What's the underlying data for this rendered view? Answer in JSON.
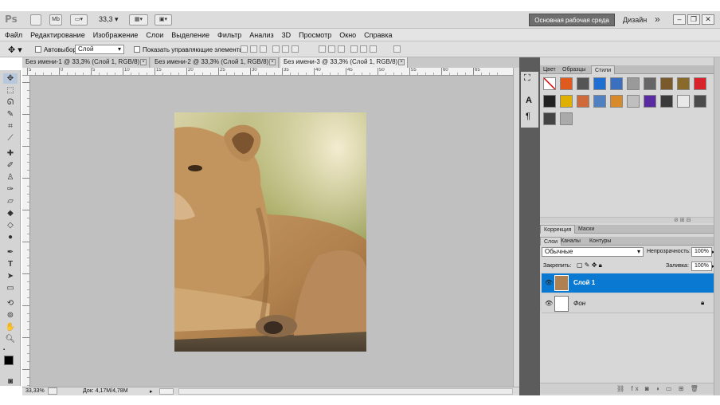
{
  "appbar": {
    "logo": "Ps",
    "mb_label": "Mb",
    "zoom_value": "33,3",
    "workspace_button": "Основная рабочая среда",
    "design_label": "Дизайн",
    "more_label": "»"
  },
  "menu": {
    "items": [
      "Файл",
      "Редактирование",
      "Изображение",
      "Слои",
      "Выделение",
      "Фильтр",
      "Анализ",
      "3D",
      "Просмотр",
      "Окно",
      "Справка"
    ]
  },
  "options": {
    "autoselect_label": "Автовыбор:",
    "autoselect_value": "Слой",
    "show_controls_label": "Показать управляющие элементы"
  },
  "tabs": [
    {
      "label": "Без имени-1 @ 33,3% (Слой 1, RGB/8) *"
    },
    {
      "label": "Без имени-2 @ 33,3% (Слой 1, RGB/8) *"
    },
    {
      "label": "Без имени-3 @ 33,3% (Слой 1, RGB/8) *"
    }
  ],
  "ruler_labels": [
    "5",
    "0",
    "5",
    "10",
    "15",
    "20",
    "25",
    "30",
    "35",
    "40",
    "45",
    "50",
    "55",
    "60",
    "65"
  ],
  "status": {
    "zoom": "33,33%",
    "doc": "Док: 4,17M/4,78M"
  },
  "styles_panel": {
    "tabs": [
      "Цвет",
      "Образцы",
      "Стили"
    ],
    "active_tab": "Стили",
    "swatch_colors": [
      "#ffffff",
      "#e05a1e",
      "#555555",
      "#1e6fd1",
      "#3b6fbf",
      "#9a9a9a",
      "#666666",
      "#7a5a2a",
      "#8a6a2a",
      "#d8232a",
      "#222222",
      "#e0b000",
      "#d06a3a",
      "#5080c0",
      "#d88a2a",
      "#bfbfbf",
      "#5a2aa0",
      "#3a3a3a",
      "#e8e8e8",
      "#4a4a4a",
      "#444444",
      "#aaaaaa"
    ]
  },
  "adjust_panel": {
    "tabs": [
      "Коррекция",
      "Маски"
    ]
  },
  "layers_panel": {
    "tabs": [
      "Слои",
      "Каналы",
      "Контуры"
    ],
    "blend_mode": "Обычные",
    "opacity_label": "Непрозрачность:",
    "opacity_value": "100%",
    "lock_label": "Закрепить:",
    "fill_label": "Заливка:",
    "fill_value": "100%",
    "layers": [
      {
        "name": "Слой 1",
        "selected": true
      },
      {
        "name": "Фон",
        "selected": false
      }
    ]
  }
}
